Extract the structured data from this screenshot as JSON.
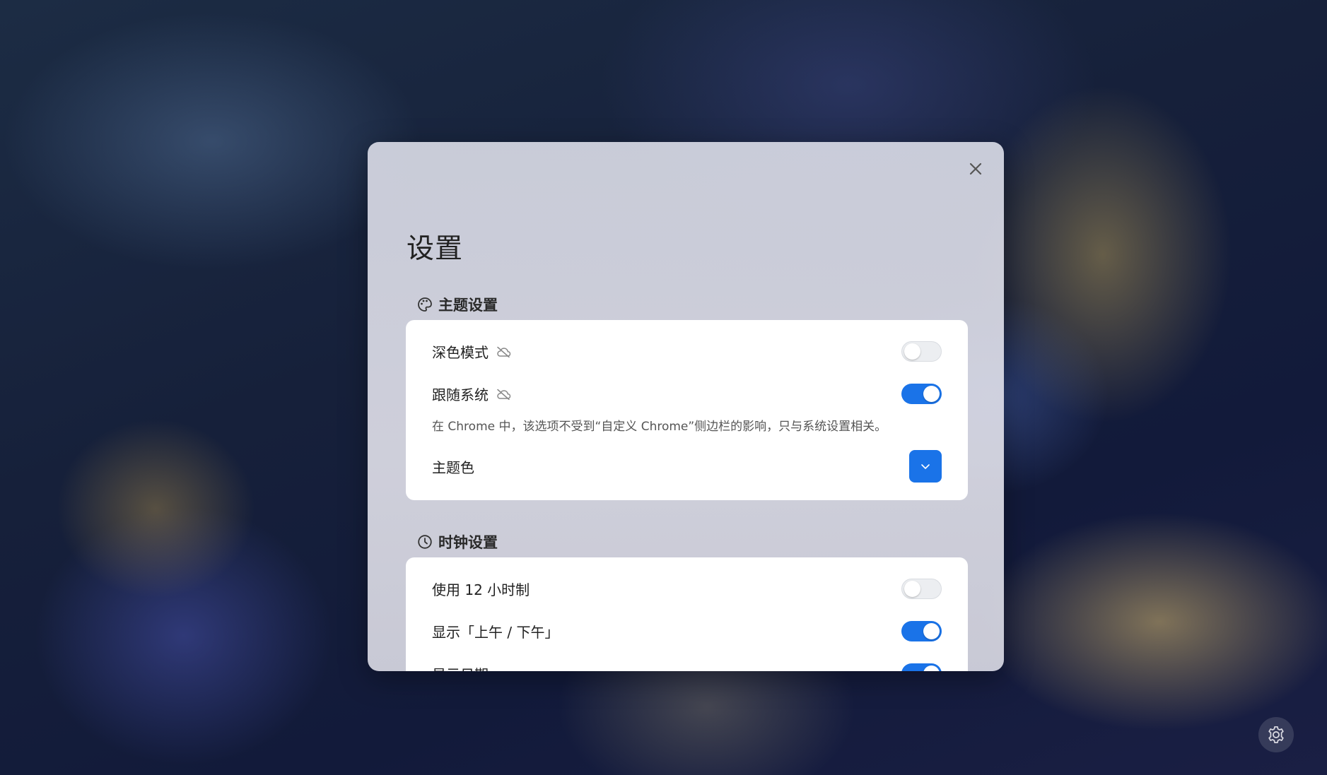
{
  "dialog": {
    "title": "设置",
    "close_icon": "close-icon"
  },
  "theme_section": {
    "header": "主题设置",
    "icon": "palette-icon",
    "dark_mode": {
      "label": "深色模式",
      "icon": "cloud-off-icon",
      "enabled": false
    },
    "follow_system": {
      "label": "跟随系统",
      "icon": "cloud-off-icon",
      "enabled": true
    },
    "note": "在 Chrome 中，该选项不受到“自定义 Chrome”侧边栏的影响，只与系统设置相关。",
    "theme_color": {
      "label": "主题色",
      "value_color": "#1a73e8",
      "icon": "chevron-down-icon"
    }
  },
  "clock_section": {
    "header": "时钟设置",
    "icon": "clock-icon",
    "use_12h": {
      "label": "使用 12 小时制",
      "enabled": false
    },
    "show_ampm": {
      "label": "显示「上午 / 下午」",
      "enabled": true
    },
    "show_date": {
      "label": "显示日期",
      "enabled": true
    }
  },
  "fab": {
    "icon": "gear-icon"
  },
  "colors": {
    "accent": "#1a73e8",
    "toggle_off": "#eceef1"
  }
}
